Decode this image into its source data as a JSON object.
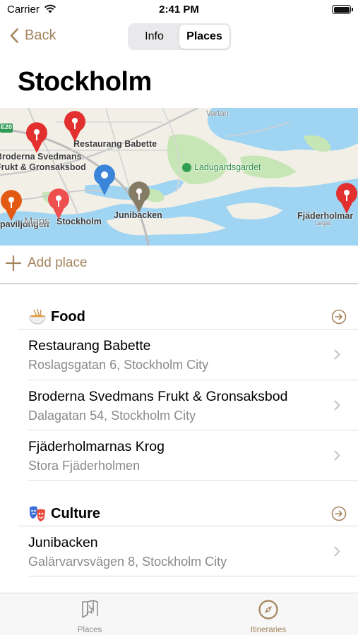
{
  "status_bar": {
    "carrier": "Carrier",
    "time": "2:41 PM"
  },
  "nav": {
    "back_label": "Back",
    "segments": [
      "Info",
      "Places"
    ],
    "selected_segment": "Places"
  },
  "title": "Stockholm",
  "map": {
    "labels": {
      "road": "E20",
      "vartan": "Vartan",
      "babette": "Restaurang Babette",
      "broderna1": "Broderna Svedmans",
      "broderna2": "Frukt & Gronsaksbod",
      "ladugard": "Ladugardsgardet",
      "junibacken": "Junibacken",
      "stockholm": "Stockholm",
      "paviljongen": "paviljongen",
      "maps": "Maps",
      "fjaderholmar": "Fjäderholmar",
      "legal": "Legal"
    },
    "pin_colors": {
      "red": "#e2302f",
      "blue": "#3a85d9",
      "olive": "#857c65",
      "orange": "#e25a13",
      "coral": "#ee4f4f"
    }
  },
  "add_place_label": "Add place",
  "sections": [
    {
      "title": "Food",
      "icon": "noodle-bowl-icon",
      "items": [
        {
          "name": "Restaurang Babette",
          "address": "Roslagsgatan 6, Stockholm City"
        },
        {
          "name": "Broderna Svedmans Frukt & Gronsaksbod",
          "address": "Dalagatan 54, Stockholm City"
        },
        {
          "name": "Fjäderholmarnas Krog",
          "address": "Stora Fjäderholmen"
        }
      ]
    },
    {
      "title": "Culture",
      "icon": "theater-masks-icon",
      "items": [
        {
          "name": "Junibacken",
          "address": "Galärvarvsvägen 8, Stockholm City"
        }
      ]
    }
  ],
  "tabbar": {
    "places_label": "Places",
    "itineraries_label": "Itineraries",
    "selected": "Itineraries"
  },
  "colors": {
    "accent": "#a4845c",
    "secondary_text": "#8a8a8e",
    "water": "#9fd4f2",
    "park": "#c7e6b5"
  }
}
